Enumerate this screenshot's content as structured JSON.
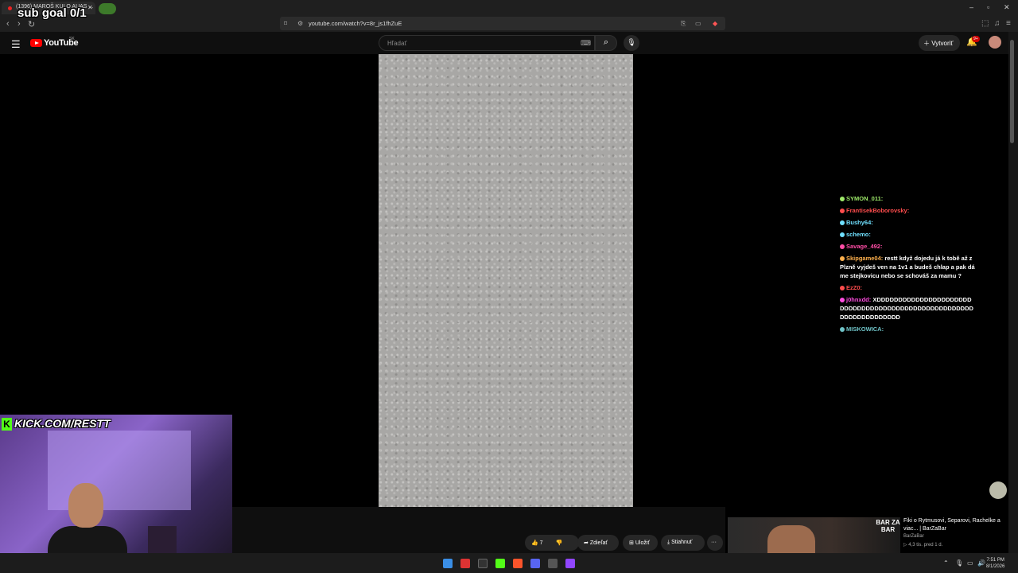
{
  "browser": {
    "tab_title": "(1396) MAROŠ KULO AUAS ...",
    "url": "youtube.com/watch?v=8r_js1fhZuE",
    "overlay_text": "sub goal 0/1"
  },
  "youtube": {
    "logo_text": "YouTube",
    "region": "SK",
    "search_placeholder": "Hľadať",
    "create_label": "Vytvoriť",
    "notif_badge": "9+"
  },
  "chat": [
    {
      "user": "SYMON_011:",
      "msg": "",
      "color": "#9eea6a"
    },
    {
      "user": "FrantisekBoborovsky:",
      "msg": "",
      "color": "#ff4d4d"
    },
    {
      "user": "Bushy64:",
      "msg": "",
      "color": "#6fe0ff"
    },
    {
      "user": "schemo:",
      "msg": "",
      "color": "#6fe0ff"
    },
    {
      "user": "Savage_492:",
      "msg": "",
      "color": "#ff4da6"
    },
    {
      "user": "Skipgame04:",
      "msg": "restt když dojedu já k tobě až z Plzně vyjdeš ven na 1v1 a budeš chlap a pak dáme stejkovicu nebo se schováš za mamu ?",
      "color": "#ffb14d"
    },
    {
      "user": "EzZ0:",
      "msg": "",
      "color": "#ff4d4d"
    },
    {
      "user": "j0hnxdd:",
      "msg": "XDDDDDDDDDDDDDDDDDDDDDDDDDDDDDDDDDDDDDDDDDDDDDDDDDDDDDDDDDDDDDDDDDDD",
      "color": "#ff4de0"
    },
    {
      "user": "MISKOWICA:",
      "msg": "",
      "color": "#6fc3c7"
    }
  ],
  "webcam": {
    "kick_url": "KICK.COM/RESTT",
    "kick_letter": "K"
  },
  "actions": {
    "like_count": "7",
    "share": "Zdieľať",
    "save": "Uložiť",
    "download": "Stiahnuť",
    "more": "···"
  },
  "recommendation": {
    "title": "Fiki o Rytmusovi, Separovi, Rachelke a viac... | BarZaBar",
    "channel": "BarZaBar",
    "meta": "▷ 4,3 tis.   pred 1 d.",
    "badge": "BAR ZA BAR"
  },
  "taskbar": {
    "time": "7:51 PM",
    "date": "8/1/2026"
  },
  "colors": {
    "accent_red": "#ff0000",
    "kick_green": "#53fc18"
  }
}
